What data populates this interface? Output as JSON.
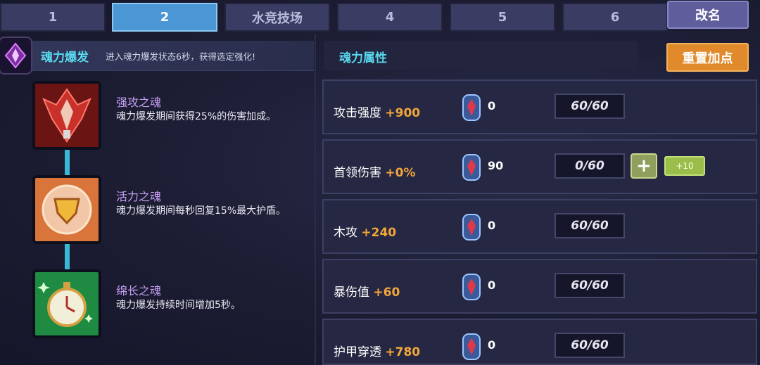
{
  "tabs": [
    {
      "label": "1"
    },
    {
      "label": "2"
    },
    {
      "label": "水竞技场"
    },
    {
      "label": "4"
    },
    {
      "label": "5"
    },
    {
      "label": "6"
    }
  ],
  "active_tab": 1,
  "rename_label": "改名",
  "soul_burst": {
    "title": "魂力爆发",
    "description": "进入魂力爆发状态6秒，获得选定强化!"
  },
  "souls": [
    {
      "name": "强攻之魂",
      "desc": "魂力爆发期间获得25%的伤害加成。",
      "icon": "red-armor-icon"
    },
    {
      "name": "活力之魂",
      "desc": "魂力爆发期间每秒回复15%最大护盾。",
      "icon": "gold-shield-icon"
    },
    {
      "name": "绵长之魂",
      "desc": "魂力爆发持续时间增加5秒。",
      "icon": "stopwatch-icon"
    }
  ],
  "attributes_title": "魂力属性",
  "reset_label": "重置加点",
  "stats": [
    {
      "name": "攻击强度",
      "value": "+900",
      "stones": "0",
      "level": "60/60"
    },
    {
      "name": "首领伤害",
      "value": "+0%",
      "stones": "90",
      "level": "0/60",
      "plus": "+",
      "plus10": "+10"
    },
    {
      "name": "木攻",
      "value": "+240",
      "stones": "0",
      "level": "60/60"
    },
    {
      "name": "暴伤值",
      "value": "+60",
      "stones": "0",
      "level": "60/60"
    },
    {
      "name": "护甲穿透",
      "value": "+780",
      "stones": "0",
      "level": "60/60"
    }
  ],
  "colors": {
    "accent_cyan": "#5ad8ee",
    "stat_orange": "#f3a63a",
    "reset_orange": "#e08a2c",
    "tab_active": "#4b97d6"
  }
}
